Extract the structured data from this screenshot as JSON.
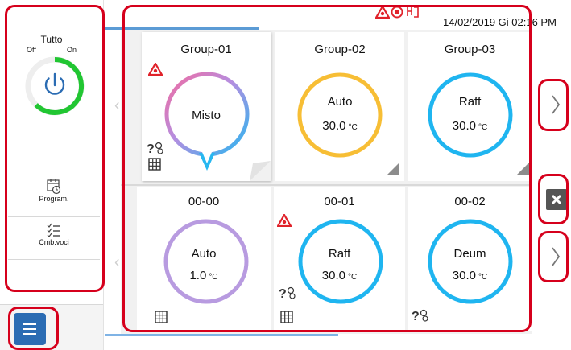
{
  "status": {
    "datetime": "14/02/2019 Gi 02:16 PM",
    "icons": [
      "alarm-triangle-icon",
      "no-entry-icon",
      "network-icon"
    ]
  },
  "left_panel": {
    "all_label": "Tutto",
    "off_label": "Off",
    "on_label": "On",
    "power_state": "on",
    "menu_items": [
      {
        "label": "Program.",
        "icon": "calendar-clock-icon"
      },
      {
        "label": "Cmb.voci",
        "icon": "checklist-icon"
      }
    ],
    "menu_button_icon": "hamburger-icon"
  },
  "groups": [
    {
      "title": "Group-01",
      "mode": "Misto",
      "temp": "",
      "unit": "",
      "ring": "gradient",
      "alarm": true,
      "status_icon": true,
      "grid_icon": true,
      "selected": true
    },
    {
      "title": "Group-02",
      "mode": "Auto",
      "temp": "30.0",
      "unit": "°C",
      "ring": "#f7be35",
      "alarm": false,
      "status_icon": false,
      "grid_icon": false,
      "selected": false
    },
    {
      "title": "Group-03",
      "mode": "Raff",
      "temp": "30.0",
      "unit": "°C",
      "ring": "#1fb5f0",
      "alarm": false,
      "status_icon": false,
      "grid_icon": false,
      "selected": false
    },
    {
      "title": "00-00",
      "mode": "Auto",
      "temp": "1.0",
      "unit": "°C",
      "ring": "#b89be0",
      "alarm": false,
      "status_icon": false,
      "grid_icon": true,
      "selected": false
    },
    {
      "title": "00-01",
      "mode": "Raff",
      "temp": "30.0",
      "unit": "°C",
      "ring": "#1fb5f0",
      "alarm": true,
      "status_icon": true,
      "grid_icon": true,
      "selected": false
    },
    {
      "title": "00-02",
      "mode": "Deum",
      "temp": "30.0",
      "unit": "°C",
      "ring": "#1fb5f0",
      "alarm": false,
      "status_icon": true,
      "grid_icon": false,
      "selected": false
    }
  ],
  "colors": {
    "highlight_red": "#d6001c",
    "menu_blue": "#2b6cb3",
    "power_green": "#21c632",
    "alarm_red": "#e0222a"
  }
}
